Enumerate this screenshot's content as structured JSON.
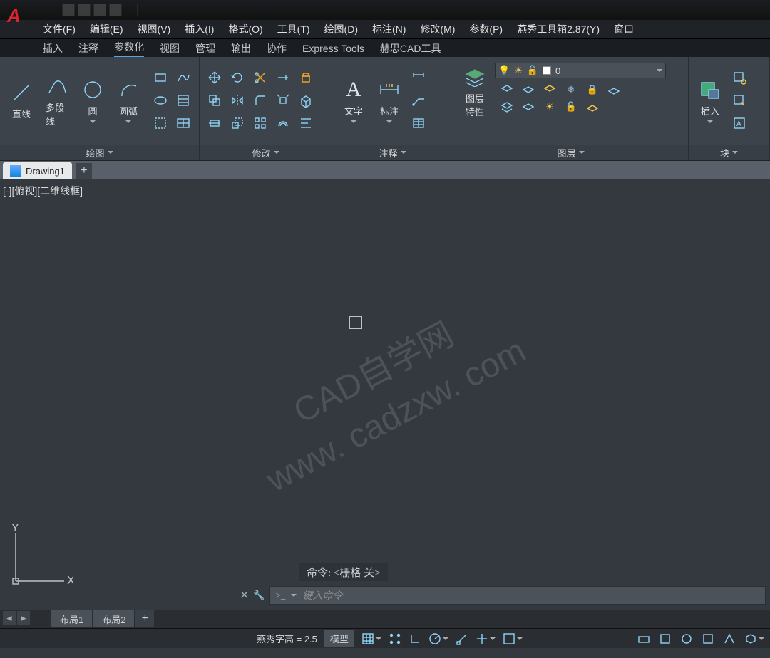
{
  "app_logo": "A",
  "menubar": [
    "文件(F)",
    "编辑(E)",
    "视图(V)",
    "插入(I)",
    "格式(O)",
    "工具(T)",
    "绘图(D)",
    "标注(N)",
    "修改(M)",
    "参数(P)",
    "燕秀工具箱2.87(Y)",
    "窗口"
  ],
  "ribbon_tabs": [
    "插入",
    "注释",
    "参数化",
    "视图",
    "管理",
    "输出",
    "协作",
    "Express Tools",
    "赫思CAD工具"
  ],
  "panels": {
    "draw": {
      "title": "绘图",
      "tools": [
        "直线",
        "多段线",
        "圆",
        "圆弧"
      ]
    },
    "modify": {
      "title": "修改"
    },
    "annotate": {
      "title": "注释",
      "tools": [
        "文字",
        "标注"
      ]
    },
    "layers": {
      "title": "图层",
      "main": "图层\n特性",
      "current": "0"
    },
    "block": {
      "title": "块",
      "main": "插入"
    }
  },
  "doc_tab": "Drawing1",
  "viewport_label": "[-][俯视][二维线框]",
  "watermark_top": "CAD自学网",
  "watermark_bottom": "www. cadzxw. com",
  "cmd_history": "命令:  <栅格 关>",
  "cmd_prompt": ">_",
  "cmd_placeholder": "键入命令",
  "layout_tabs": [
    "布局1",
    "布局2"
  ],
  "status": {
    "text_height": "燕秀字高 = 2.5",
    "model": "模型"
  },
  "ucs": {
    "x": "X",
    "y": "Y"
  }
}
